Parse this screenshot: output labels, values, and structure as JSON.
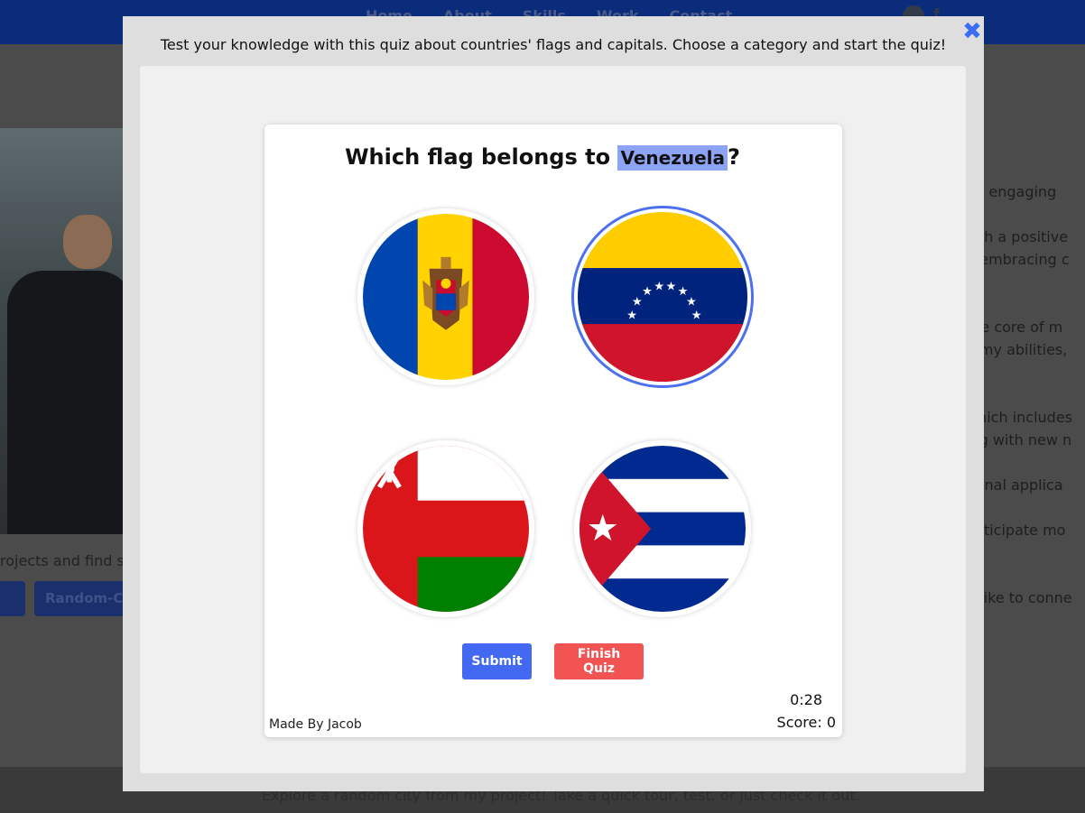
{
  "background_page": {
    "nav_links": [
      "Home",
      "About",
      "Skills",
      "Work",
      "Contact"
    ],
    "nav_icon_letter": "f",
    "left_text": "rojects and find so",
    "left_button_2": "Random-Cit",
    "right_lines": [
      "nd engaging",
      "",
      "vith a positive",
      "d embracing c",
      "",
      "",
      "the core of m",
      "e my abilities,",
      "",
      "",
      "which includes",
      "ing with new n",
      "",
      "tional applica",
      "",
      "anticipate mo",
      "",
      "",
      "d like to conne"
    ],
    "footer_text": "Explore a random city from my project! Take a quick tour, test, or just check it out."
  },
  "modal": {
    "intro": "Test your knowledge with this quiz about countries' flags and capitals. Choose a category and start the quiz!",
    "close_icon": "✖"
  },
  "quiz": {
    "question_prefix": "Which flag belongs to ",
    "country": "Venezuela",
    "question_suffix": "?",
    "options": [
      {
        "flag": "moldova-flag-icon",
        "selected": false
      },
      {
        "flag": "venezuela-flag-icon",
        "selected": true
      },
      {
        "flag": "oman-flag-icon",
        "selected": false
      },
      {
        "flag": "cuba-flag-icon",
        "selected": false
      }
    ],
    "submit_label": "Submit",
    "finish_label": "Finish Quiz",
    "timer": "0:28",
    "score": "Score: 0",
    "credit": "Made By Jacob"
  },
  "colors": {
    "accent": "#4369f2",
    "danger": "#f25454",
    "highlight": "#8ca3f6",
    "selected_ring": "#4c70ef"
  }
}
